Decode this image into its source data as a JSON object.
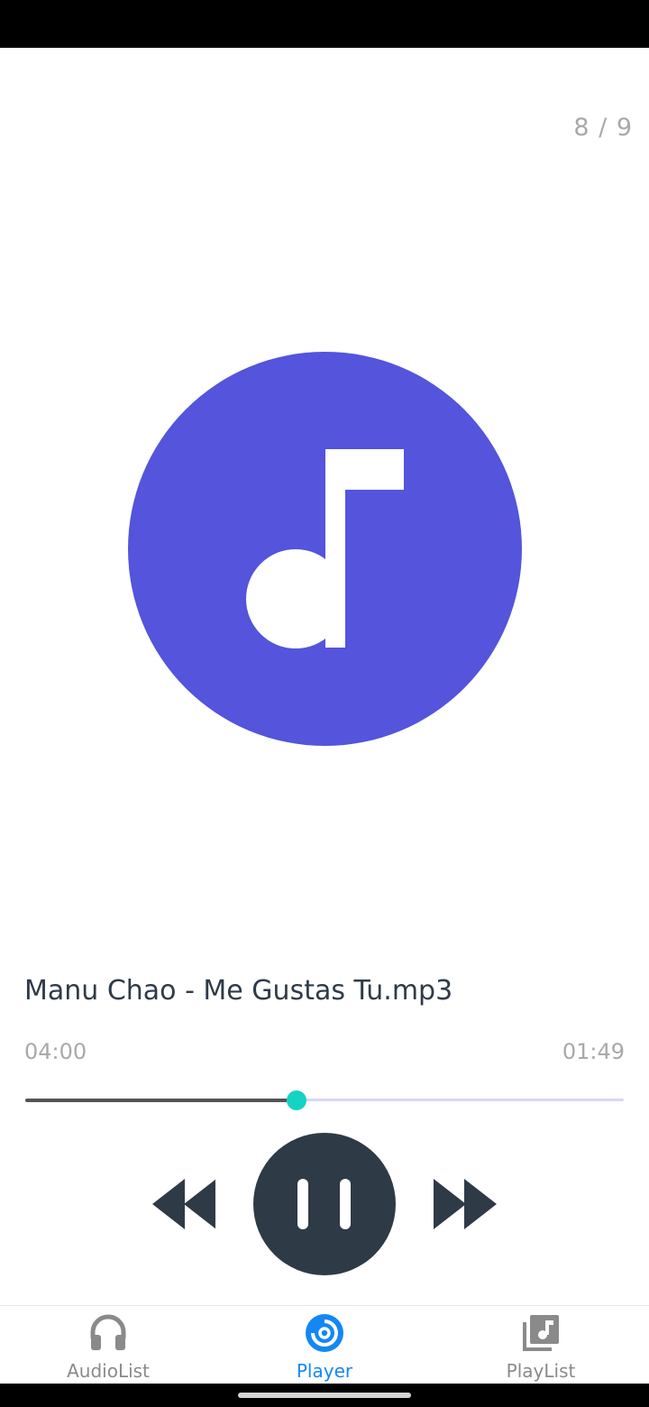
{
  "player": {
    "track_position": "8 / 9",
    "song_title": "Manu Chao - Me Gustas Tu.mp3",
    "time_elapsed": "04:00",
    "time_remaining": "01:49",
    "progress": 0.453,
    "album_icon": "music-note-icon",
    "controls": {
      "rewind_icon": "rewind-icon",
      "pause_icon": "pause-icon",
      "forward_icon": "fast-forward-icon"
    }
  },
  "bottom_nav": {
    "items": [
      {
        "label": "AudioList",
        "icon": "headphones-icon",
        "active": false
      },
      {
        "label": "Player",
        "icon": "disc-icon",
        "active": true
      },
      {
        "label": "PlayList",
        "icon": "playlist-icon",
        "active": false
      }
    ]
  },
  "colors": {
    "album_bg": "#5454dc",
    "accent": "#1487f5",
    "seek_thumb": "#14d3c4",
    "control_dark": "#2f3a47"
  }
}
